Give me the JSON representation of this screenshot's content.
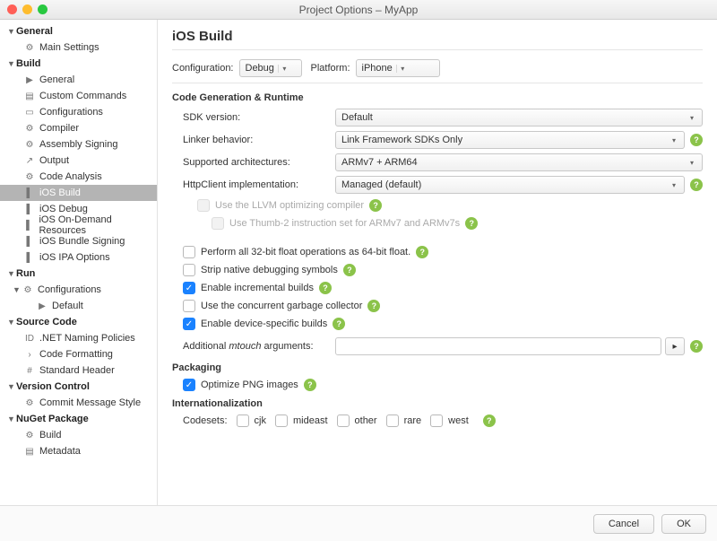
{
  "window": {
    "title": "Project Options – MyApp"
  },
  "sidebar": {
    "sections": [
      {
        "label": "General",
        "children": [
          {
            "label": "Main Settings",
            "icon": "gear"
          }
        ]
      },
      {
        "label": "Build",
        "children": [
          {
            "label": "General",
            "icon": "play"
          },
          {
            "label": "Custom Commands",
            "icon": "doc"
          },
          {
            "label": "Configurations",
            "icon": "box"
          },
          {
            "label": "Compiler",
            "icon": "gear"
          },
          {
            "label": "Assembly Signing",
            "icon": "gear"
          },
          {
            "label": "Output",
            "icon": "out"
          },
          {
            "label": "Code Analysis",
            "icon": "gear"
          },
          {
            "label": "iOS Build",
            "icon": "bar",
            "selected": true
          },
          {
            "label": "iOS Debug",
            "icon": "bar"
          },
          {
            "label": "iOS On-Demand Resources",
            "icon": "bar"
          },
          {
            "label": "iOS Bundle Signing",
            "icon": "bar"
          },
          {
            "label": "iOS IPA Options",
            "icon": "bar"
          }
        ]
      },
      {
        "label": "Run",
        "children": [
          {
            "label": "Configurations",
            "icon": "gear",
            "children": [
              {
                "label": "Default",
                "icon": "play"
              }
            ]
          }
        ]
      },
      {
        "label": "Source Code",
        "children": [
          {
            "label": ".NET Naming Policies",
            "icon": "id"
          },
          {
            "label": "Code Formatting",
            "icon": "chev"
          },
          {
            "label": "Standard Header",
            "icon": "hash"
          }
        ]
      },
      {
        "label": "Version Control",
        "children": [
          {
            "label": "Commit Message Style",
            "icon": "gear"
          }
        ]
      },
      {
        "label": "NuGet Package",
        "children": [
          {
            "label": "Build",
            "icon": "gear"
          },
          {
            "label": "Metadata",
            "icon": "doc"
          }
        ]
      }
    ]
  },
  "page": {
    "title": "iOS Build",
    "config_label": "Configuration:",
    "config_value": "Debug",
    "platform_label": "Platform:",
    "platform_value": "iPhone",
    "section_codegen": "Code Generation & Runtime",
    "sdk_label": "SDK version:",
    "sdk_value": "Default",
    "linker_label": "Linker behavior:",
    "linker_value": "Link Framework SDKs Only",
    "arch_label": "Supported architectures:",
    "arch_value": "ARMv7 + ARM64",
    "http_label": "HttpClient implementation:",
    "http_value": "Managed (default)",
    "llvm_label": "Use the LLVM optimizing compiler",
    "thumb_label": "Use Thumb-2 instruction set for ARMv7 and ARMv7s",
    "float32_label": "Perform all 32-bit float operations as 64-bit float.",
    "strip_label": "Strip native debugging symbols",
    "incremental_label": "Enable incremental builds",
    "gc_label": "Use the concurrent garbage collector",
    "devspec_label": "Enable device-specific builds",
    "mtouch_label": "Additional mtouch arguments:",
    "mtouch_value": "",
    "section_packaging": "Packaging",
    "png_label": "Optimize PNG images",
    "section_i18n": "Internationalization",
    "codesets_label": "Codesets:",
    "codesets": [
      "cjk",
      "mideast",
      "other",
      "rare",
      "west"
    ]
  },
  "footer": {
    "cancel": "Cancel",
    "ok": "OK"
  },
  "checks": {
    "llvm": false,
    "thumb": false,
    "float32": false,
    "strip": false,
    "incremental": true,
    "gc": false,
    "devspec": true,
    "png": true,
    "cjk": false,
    "mideast": false,
    "other": false,
    "rare": false,
    "west": false
  }
}
